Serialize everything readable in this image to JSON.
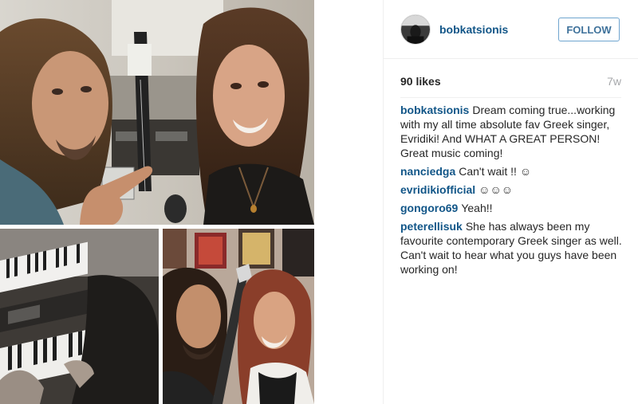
{
  "post": {
    "author": "bobkatsionis",
    "follow_label": "FOLLOW",
    "likes": "90 likes",
    "age": "7w"
  },
  "comments": [
    {
      "user": "bobkatsionis",
      "text": "Dream coming true...working with my all time absolute fav Greek singer, Evridiki! And WHAT A GREAT PERSON! Great music coming!"
    },
    {
      "user": "nanciedga",
      "text": "Can't wait !! ☺"
    },
    {
      "user": "evridikiofficial",
      "text": "☺☺☺"
    },
    {
      "user": "gongoro69",
      "text": "Yeah!!"
    },
    {
      "user": "peterellisuk",
      "text": "She has always been my favourite contemporary Greek singer as well. Can't wait to hear what you guys have been working on!"
    }
  ],
  "colors": {
    "username": "#125688",
    "follow_border": "#6fa5cf",
    "follow_text": "#3f729b",
    "muted": "#a5a7aa"
  },
  "icons": {
    "avatar": "profile-photo"
  }
}
